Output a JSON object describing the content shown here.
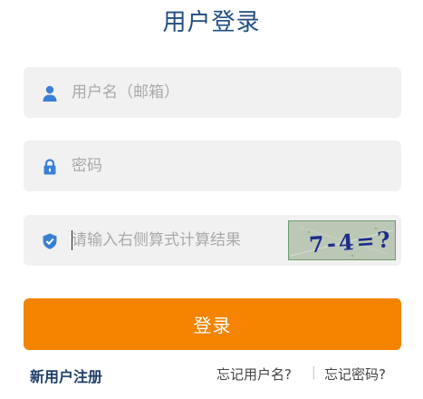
{
  "title": "用户登录",
  "form": {
    "username_placeholder": "用户名（邮箱）",
    "password_placeholder": "密码",
    "captcha_placeholder": "请输入右侧算式计算结果",
    "captcha_text": "7-4=?"
  },
  "actions": {
    "login_label": "登录",
    "register_label": "新用户注册",
    "forgot_username_label": "忘记用户名?",
    "separator": "|",
    "forgot_password_label": "忘记密码?"
  },
  "colors": {
    "title": "#1f4e82",
    "icon": "#3a7fd5",
    "field_bg": "#f1f1f1",
    "button": "#f48400",
    "register_link": "#1f3f6b"
  },
  "icons": {
    "username": "user-icon",
    "password": "lock-icon",
    "captcha": "shield-check-icon"
  }
}
